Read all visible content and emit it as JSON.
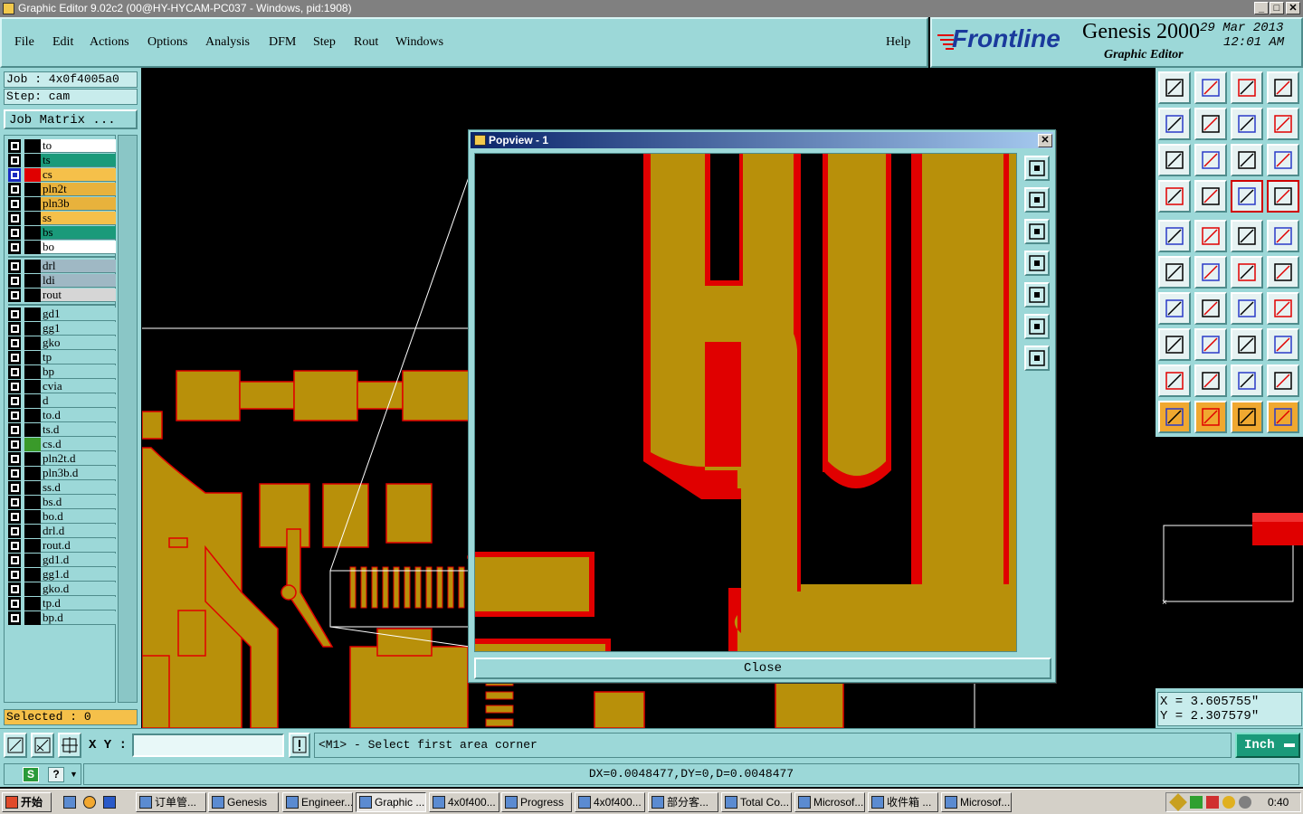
{
  "window": {
    "title": "Graphic Editor 9.02c2 (00@HY-HYCAM-PC037 - Windows, pid:1908)",
    "min_glyph": "_",
    "max_glyph": "□",
    "close_glyph": "✕"
  },
  "menu": {
    "items": [
      "File",
      "Edit",
      "Actions",
      "Options",
      "Analysis",
      "DFM",
      "Step",
      "Rout",
      "Windows"
    ],
    "help": "Help"
  },
  "brand": {
    "logo": "Frontline",
    "product": "Genesis 2000",
    "subtitle": "Graphic Editor",
    "date": "29 Mar 2013",
    "time": "12:01 AM"
  },
  "job": {
    "job_label": "Job : 4x0f4005a0",
    "step_label": "Step: cam",
    "matrix_button": "Job Matrix ...",
    "selected": "Selected : 0"
  },
  "layers": {
    "group1": [
      {
        "name": "to",
        "color": "#ffffff",
        "swatch": "#000000"
      },
      {
        "name": "ts",
        "color": "#1a9a7a",
        "swatch": "#000000"
      },
      {
        "name": "cs",
        "color": "#f5c04a",
        "swatch": "#e00000"
      },
      {
        "name": "pln2t",
        "color": "#e8b23c",
        "swatch": "#000000"
      },
      {
        "name": "pln3b",
        "color": "#e8b23c",
        "swatch": "#000000"
      },
      {
        "name": "ss",
        "color": "#f5c04a",
        "swatch": "#000000"
      },
      {
        "name": "bs",
        "color": "#1a9a7a",
        "swatch": "#000000"
      },
      {
        "name": "bo",
        "color": "#ffffff",
        "swatch": "#000000"
      }
    ],
    "group2": [
      {
        "name": "drl",
        "color": "#9fb8c4",
        "swatch": "#000000"
      },
      {
        "name": "ldi",
        "color": "#9fb8c4",
        "swatch": "#000000"
      },
      {
        "name": "rout",
        "color": "#d6d6d6",
        "swatch": "#000000"
      }
    ],
    "group3": [
      {
        "name": "gd1",
        "color": "#9cd8d8",
        "swatch": "#000000"
      },
      {
        "name": "gg1",
        "color": "#9cd8d8",
        "swatch": "#000000"
      },
      {
        "name": "gko",
        "color": "#9cd8d8",
        "swatch": "#000000"
      },
      {
        "name": "tp",
        "color": "#9cd8d8",
        "swatch": "#000000"
      },
      {
        "name": "bp",
        "color": "#9cd8d8",
        "swatch": "#000000"
      },
      {
        "name": "cvia",
        "color": "#9cd8d8",
        "swatch": "#000000"
      },
      {
        "name": "d",
        "color": "#9cd8d8",
        "swatch": "#000000"
      },
      {
        "name": "to.d",
        "color": "#9cd8d8",
        "swatch": "#000000"
      },
      {
        "name": "ts.d",
        "color": "#9cd8d8",
        "swatch": "#000000"
      },
      {
        "name": "cs.d",
        "color": "#9cd8d8",
        "swatch": "#3a9a2a"
      },
      {
        "name": "pln2t.d",
        "color": "#9cd8d8",
        "swatch": "#000000"
      },
      {
        "name": "pln3b.d",
        "color": "#9cd8d8",
        "swatch": "#000000"
      },
      {
        "name": "ss.d",
        "color": "#9cd8d8",
        "swatch": "#000000"
      },
      {
        "name": "bs.d",
        "color": "#9cd8d8",
        "swatch": "#000000"
      },
      {
        "name": "bo.d",
        "color": "#9cd8d8",
        "swatch": "#000000"
      },
      {
        "name": "drl.d",
        "color": "#9cd8d8",
        "swatch": "#000000"
      },
      {
        "name": "rout.d",
        "color": "#9cd8d8",
        "swatch": "#000000"
      },
      {
        "name": "gd1.d",
        "color": "#9cd8d8",
        "swatch": "#000000"
      },
      {
        "name": "gg1.d",
        "color": "#9cd8d8",
        "swatch": "#000000"
      },
      {
        "name": "gko.d",
        "color": "#9cd8d8",
        "swatch": "#000000"
      },
      {
        "name": "tp.d",
        "color": "#9cd8d8",
        "swatch": "#000000"
      },
      {
        "name": "bp.d",
        "color": "#9cd8d8",
        "swatch": "#000000"
      }
    ]
  },
  "popview": {
    "title": "Popview - 1",
    "close_label": "Close"
  },
  "coords": {
    "x": "X = 3.605755\"",
    "y": "Y = 2.307579\""
  },
  "command": {
    "xy_label": "X Y :",
    "xy_value": "",
    "prompt": "<M1> - Select first area corner",
    "units": "Inch"
  },
  "status": {
    "measure": "DX=0.0048477,DY=0,D=0.0048477"
  },
  "taskbar": {
    "start": "开始",
    "tasks": [
      "订单管...",
      "Genesis",
      "Engineer...",
      "Graphic ...",
      "4x0f400...",
      "Progress",
      "4x0f400...",
      "部分客...",
      "Total Co...",
      "Microsof...",
      "收件箱 ...",
      "Microsof..."
    ],
    "clock": "0:40"
  },
  "colors": {
    "panel": "#9cd8d8",
    "copper": "#b8900a",
    "highlight": "#ff0000"
  }
}
